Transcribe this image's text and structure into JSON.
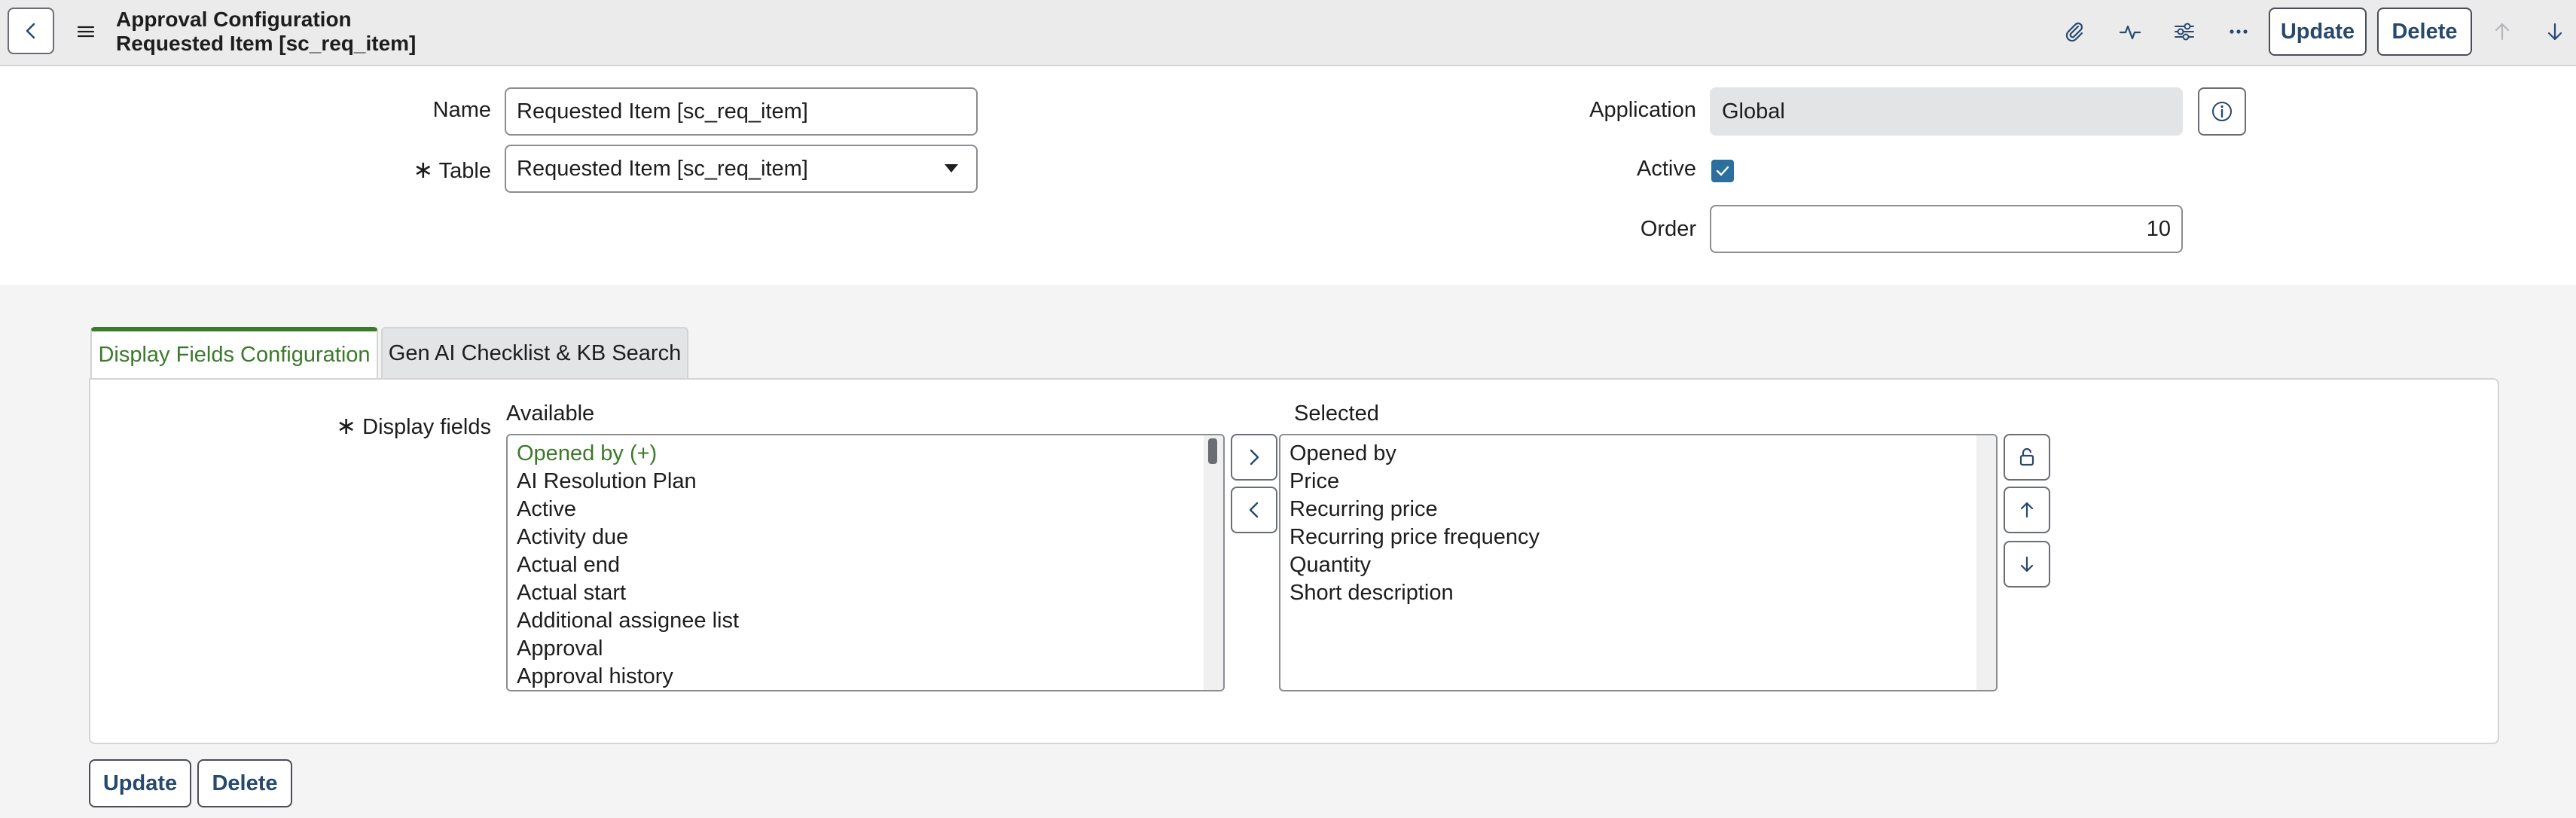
{
  "header": {
    "title_line1": "Approval Configuration",
    "title_line2": "Requested Item [sc_req_item]",
    "update_label": "Update",
    "delete_label": "Delete",
    "icons": [
      "back-icon",
      "menu-icon",
      "attachment-icon",
      "activity-icon",
      "settings-sliders-icon",
      "more-icon",
      "arrow-up-icon",
      "arrow-down-icon"
    ]
  },
  "form": {
    "name_label": "Name",
    "name_value": "Requested Item [sc_req_item]",
    "table_label": "Table",
    "table_required": "∗",
    "table_value": "Requested Item [sc_req_item]",
    "application_label": "Application",
    "application_value": "Global",
    "active_label": "Active",
    "active_checked": true,
    "order_label": "Order",
    "order_value": "10"
  },
  "tabs": [
    {
      "label": "Display Fields Configuration",
      "active": true
    },
    {
      "label": "Gen AI Checklist & KB Search",
      "active": false
    }
  ],
  "display_fields": {
    "label": "Display fields",
    "required": "∗",
    "available_header": "Available",
    "selected_header": "Selected",
    "available": [
      "Opened by (+)",
      "AI Resolution Plan",
      "Active",
      "Activity due",
      "Actual end",
      "Actual start",
      "Additional assignee list",
      "Approval",
      "Approval history"
    ],
    "selected": [
      "Opened by",
      "Price",
      "Recurring price",
      "Recurring price frequency",
      "Quantity",
      "Short description"
    ]
  },
  "footer": {
    "update_label": "Update",
    "delete_label": "Delete"
  },
  "colors": {
    "accent_green": "#3b7a2a",
    "button_text": "#27496e",
    "checkbox": "#2a6f9e"
  }
}
